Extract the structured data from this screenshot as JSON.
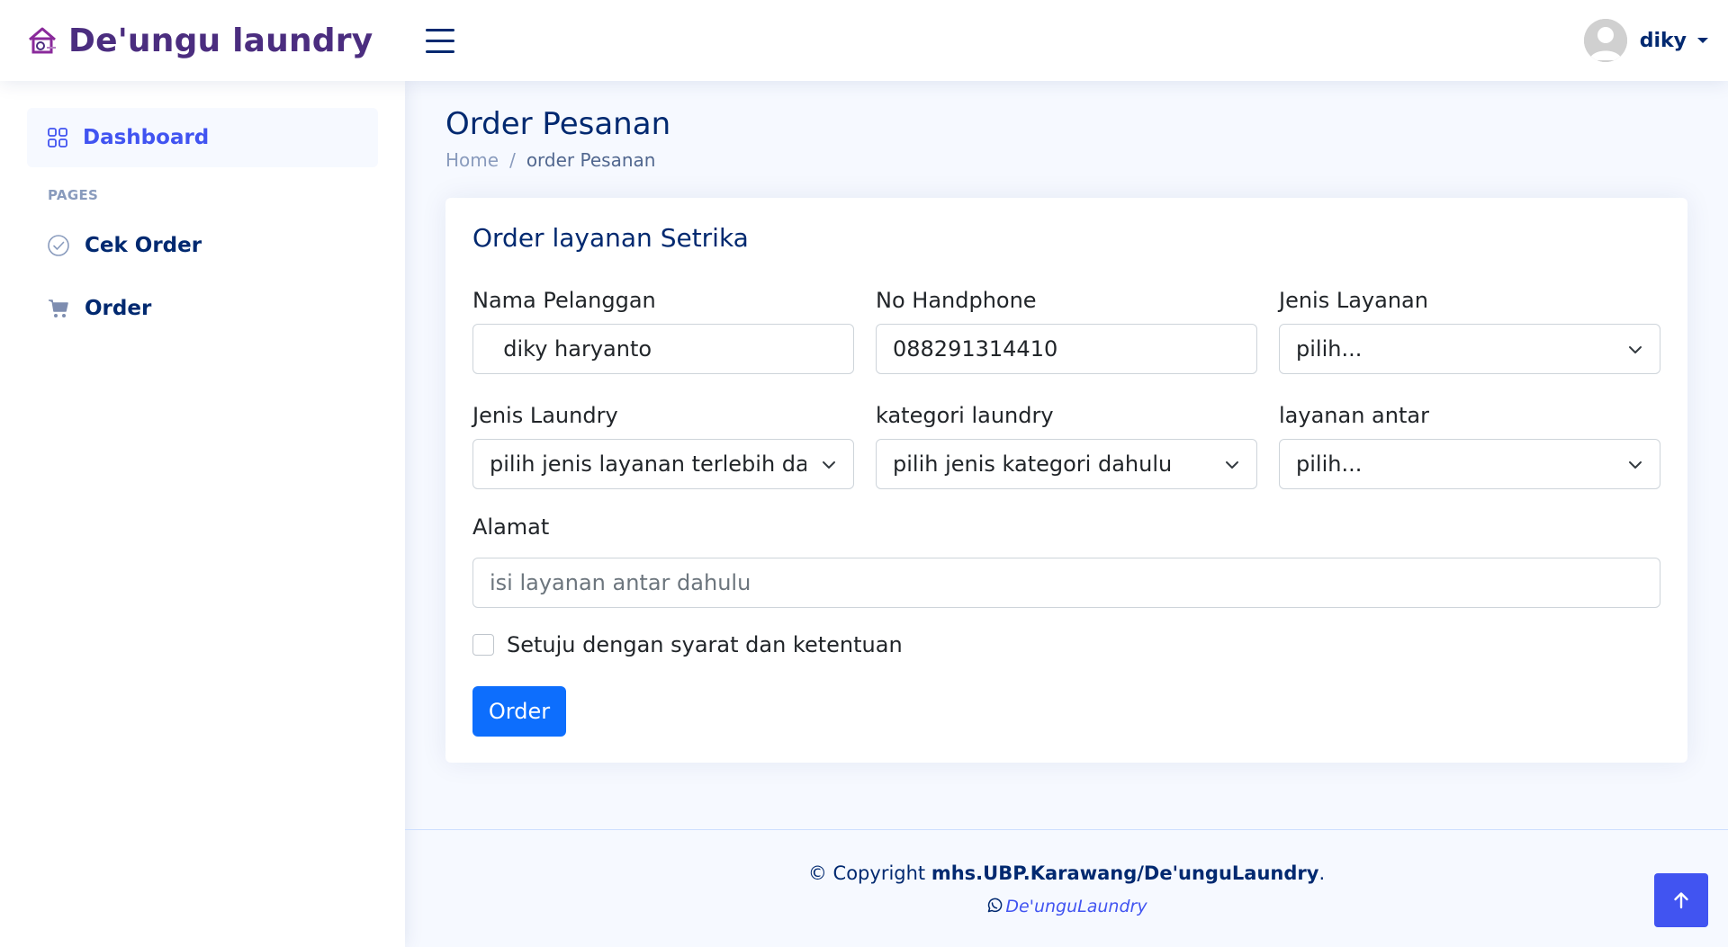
{
  "header": {
    "brand": "De'ungu laundry",
    "username": "diky"
  },
  "sidebar": {
    "dashboard_label": "Dashboard",
    "pages_heading": "PAGES",
    "items": [
      {
        "label": "Cek Order",
        "icon": "check-circle-icon"
      },
      {
        "label": "Order",
        "icon": "cart-icon"
      }
    ]
  },
  "page": {
    "title": "Order Pesanan",
    "breadcrumb": [
      "Home",
      "order Pesanan"
    ]
  },
  "form": {
    "title": "Order layanan Setrika",
    "nama": {
      "label": "Nama Pelanggan",
      "value": "  diky haryanto"
    },
    "hp": {
      "label": "No Handphone",
      "value": "088291314410"
    },
    "jenis_layanan": {
      "label": "Jenis Layanan",
      "value": "pilih..."
    },
    "jenis_laundry": {
      "label": "Jenis Laundry",
      "value": "pilih jenis layanan terlebih dahulu"
    },
    "kategori": {
      "label": "kategori laundry",
      "value": "pilih jenis kategori dahulu"
    },
    "antar": {
      "label": "layanan antar",
      "value": "pilih..."
    },
    "alamat": {
      "label": "Alamat",
      "placeholder": "isi layanan antar dahulu"
    },
    "agree_label": "Setuju dengan syarat dan ketentuan",
    "submit_label": "Order"
  },
  "footer": {
    "copyright_prefix": "© Copyright ",
    "copyright_owner": "mhs.UBP.Karawang/De'unguLaundry",
    "copyright_suffix": ".",
    "whatsapp_label": "De'unguLaundry"
  },
  "colors": {
    "brand": "#4b2d7f",
    "primary": "#0d6efd",
    "accent": "#4154f1",
    "navy": "#012970",
    "background": "#f6f9ff"
  }
}
